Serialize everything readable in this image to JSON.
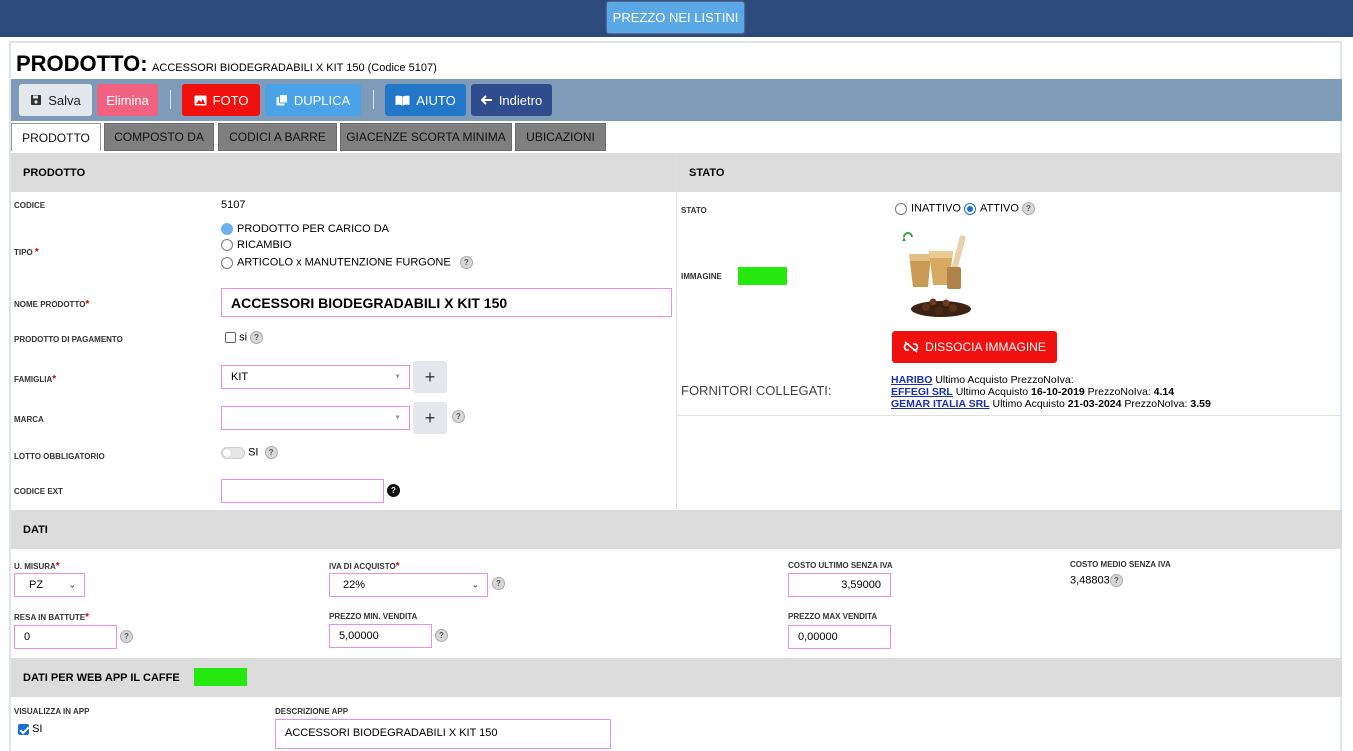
{
  "topbar": {
    "listini_label": "PREZZO NEI LISTINI"
  },
  "title": {
    "prefix": "PRODOTTO:",
    "name": "ACCESSORI BIODEGRADABILI X KIT 150 (Codice 5107)"
  },
  "toolbar": {
    "salva": "Salva",
    "elimina": "Elimina",
    "foto": "FOTO",
    "duplica": "DUPLICA",
    "aiuto": "AIUTO",
    "indietro": "Indietro"
  },
  "tabs": [
    "PRODOTTO",
    "COMPOSTO DA",
    "CODICI A BARRE",
    "GIACENZE SCORTA MINIMA",
    "UBICAZIONI"
  ],
  "prodotto": {
    "header": "PRODOTTO",
    "codice_label": "CODICE",
    "codice_value": "5107",
    "tipo_label": "TIPO",
    "tipo_options": [
      "PRODOTTO PER CARICO DA",
      "RICAMBIO",
      "ARTICOLO x MANUTENZIONE FURGONE"
    ],
    "tipo_selected": 0,
    "nome_label": "NOME PRODOTTO",
    "nome_value": "ACCESSORI BIODEGRADABILI X KIT 150",
    "pagamento_label": "PRODOTTO DI PAGAMENTO",
    "pagamento_option": "si",
    "pagamento_checked": false,
    "famiglia_label": "FAMIGLIA",
    "famiglia_value": "KIT",
    "marca_label": "MARCA",
    "marca_value": "",
    "lotto_label": "LOTTO OBBLIGATORIO",
    "lotto_option": "SI",
    "lotto_on": false,
    "codice_ext_label": "CODICE EXT",
    "codice_ext_value": "",
    "plus": "+",
    "help": "?"
  },
  "stato": {
    "header": "STATO",
    "stato_label": "STATO",
    "inattivo": "INATTIVO",
    "attivo": "ATTIVO",
    "selected": "ATTIVO",
    "immagine_label": "IMMAGINE",
    "dissocia": "DISSOCIA IMMAGINE",
    "fornitori_label": "FORNITORI COLLEGATI:",
    "fornitori": [
      {
        "name": "HARIBO",
        "text": " Ultimo Acquisto PrezzoNoIva:",
        "date": "",
        "prezzo_label": "",
        "prezzo": ""
      },
      {
        "name": "EFFEGI SRL",
        "text": " Ultimo Acquisto ",
        "date": "16-10-2019",
        "prezzo_label": " PrezzoNoIva: ",
        "prezzo": "4.14"
      },
      {
        "name": "GEMAR ITALIA SRL",
        "text": " Ultimo Acquisto ",
        "date": "21-03-2024",
        "prezzo_label": " PrezzoNoIva: ",
        "prezzo": "3.59"
      }
    ]
  },
  "dati": {
    "header": "DATI",
    "umisura_label": "U. MISURA",
    "umisura_value": "PZ",
    "iva_label": "IVA DI ACQUISTO",
    "iva_value": "22%",
    "costo_ultimo_label": "COSTO ULTIMO SENZA IVA",
    "costo_ultimo_value": "3,59000",
    "costo_medio_label": "COSTO MEDIO SENZA IVA",
    "costo_medio_value": "3,48803",
    "resa_label": "RESA IN BATTUTE",
    "resa_value": "0",
    "prezzo_min_label": "PREZZO MIN. VENDITA",
    "prezzo_min_value": "5,00000",
    "prezzo_max_label": "PREZZO MAX VENDITA",
    "prezzo_max_value": "0,00000"
  },
  "webapp": {
    "header": "DATI PER WEB APP IL CAFFE",
    "visualizza_label": "VISUALIZZA IN APP",
    "visualizza_option": "SI",
    "visualizza_checked": true,
    "descrizione_label": "DESCRIZIONE APP",
    "descrizione_value": "ACCESSORI BIODEGRADABILI X KIT 150"
  },
  "colors": {
    "topbar": "#2d4a7c",
    "toolbar": "#7e9cb9",
    "status_green": "#25e80e",
    "danger": "#f0110f"
  }
}
